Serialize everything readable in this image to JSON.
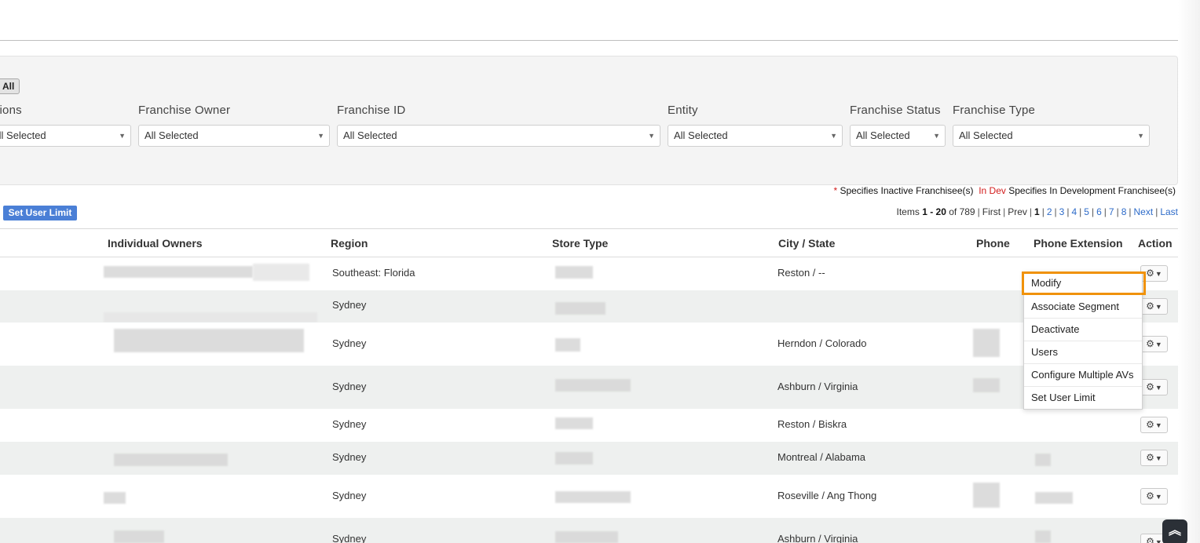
{
  "filters": {
    "all_button": "All",
    "fields": [
      {
        "label": "Divisions",
        "value": "All Selected"
      },
      {
        "label": "Franchise Owner",
        "value": "All Selected"
      },
      {
        "label": "Franchise ID",
        "value": "All Selected"
      },
      {
        "label": "Entity",
        "value": "All Selected"
      },
      {
        "label": "Franchise Status",
        "value": "All Selected"
      },
      {
        "label": "Franchise Type",
        "value": "All Selected"
      }
    ]
  },
  "legend": {
    "star": "*",
    "inactive_text": "Specifies Inactive Franchisee(s)",
    "indev_tag": "In Dev",
    "indev_text": "Specifies In Development Franchisee(s)"
  },
  "toolbar": {
    "set_user_limit": "Set User Limit"
  },
  "pagination": {
    "items_prefix": "Items",
    "range": "1 - 20",
    "of_text": "of 789",
    "first": "First",
    "prev": "Prev",
    "current": "1",
    "pages": [
      "2",
      "3",
      "4",
      "5",
      "6",
      "7",
      "8"
    ],
    "next": "Next",
    "last": "Last"
  },
  "table": {
    "headers": {
      "individual_owners": "Individual Owners",
      "region": "Region",
      "store_type": "Store Type",
      "city_state": "City / State",
      "phone": "Phone",
      "phone_extension": "Phone Extension",
      "action": "Action"
    },
    "rows": [
      {
        "region": "Southeast: Florida",
        "city_state": "Reston / --"
      },
      {
        "region": "Sydney",
        "city_state": ""
      },
      {
        "region": "Sydney",
        "city_state": "Herndon / Colorado"
      },
      {
        "region": "Sydney",
        "city_state": "Ashburn / Virginia"
      },
      {
        "region": "Sydney",
        "city_state": "Reston / Biskra"
      },
      {
        "region": "Sydney",
        "city_state": "Montreal / Alabama"
      },
      {
        "region": "Sydney",
        "city_state": "Roseville / Ang Thong"
      },
      {
        "region": "Sydney",
        "city_state": "Ashburn / Virginia"
      }
    ]
  },
  "action_menu": {
    "items": [
      "Modify",
      "Associate Segment",
      "Deactivate",
      "Users",
      "Configure Multiple AVs",
      "Set User Limit"
    ],
    "highlight_color": "#f0920a"
  },
  "icons": {
    "gear": "gear-icon",
    "caret": "chevron-down-icon",
    "scroll_top": "double-chevron-up-icon"
  },
  "colors": {
    "primary_button": "#4a7fd6",
    "link": "#2d6bc9",
    "alert_red": "#d21c1c",
    "row_stripe": "#eef0ef"
  }
}
